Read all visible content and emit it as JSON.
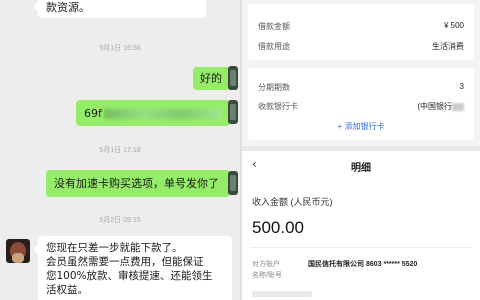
{
  "chat": {
    "top_msg_line1": "款资源。",
    "ts1": "5月1日 16:56",
    "msg_hao": "好的",
    "msg_code_prefix": "69f",
    "ts2": "5月1日 17:18",
    "msg_no_card": "没有加速卡购买选项，单号发你了",
    "ts3": "5月2日 09:15",
    "incoming_lines": [
      "您现在只差一步就能下款了。",
      "会员虽然需要一点费用，但能保证",
      "您100%放款、审核提速、还能领生",
      "活权益。"
    ]
  },
  "order": {
    "loan_amount_label": "借款金额",
    "loan_amount_value": "¥ 500",
    "loan_purpose_label": "借款用途",
    "loan_purpose_value": "生活消费",
    "installments_label": "分期期数",
    "installments_value": "3",
    "bank_card_label": "收款银行卡",
    "bank_card_value": "(中国银行",
    "add_bank_label": "+ 添加银行卡"
  },
  "detail": {
    "back_icon": "chevron-left",
    "title": "明细",
    "income_label": "收入金额 (人民币元)",
    "income_value": "500.00",
    "counterparty_label_1": "对方账户",
    "counterparty_label_2": "名称/账号",
    "counterparty_value": "国民信托有限公司 8603 ****** 5520"
  },
  "colors": {
    "chat_bg": "#ededed",
    "outgoing_bubble": "#95ec69",
    "incoming_bubble": "#ffffff",
    "link_blue": "#2e6cd6"
  }
}
